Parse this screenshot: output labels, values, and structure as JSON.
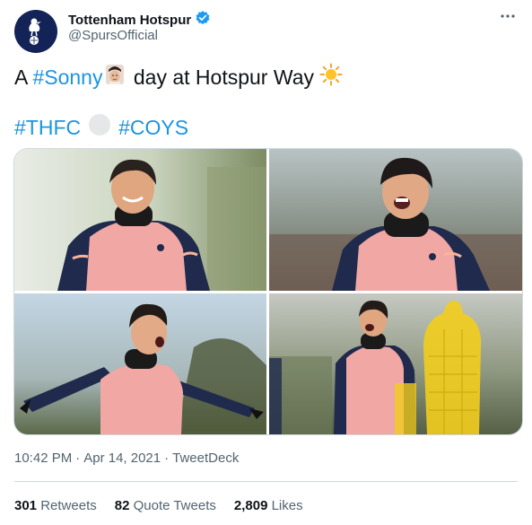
{
  "author": {
    "display_name": "Tottenham Hotspur",
    "handle": "@SpursOfficial",
    "verified": true,
    "avatar_bg": "#132257"
  },
  "tweet": {
    "line1": {
      "prefix": "A ",
      "hashtag": "#Sonny",
      "suffix": " day at Hotspur Way",
      "emoji_1": "face-icon",
      "emoji_2": "sun-icon"
    },
    "line2": {
      "hashtag_1": "#THFC",
      "hashtag_2": "#COYS",
      "emoji": "white-circle-icon"
    },
    "hashtag_color": "#1b95e0"
  },
  "meta": {
    "time": "10:42 PM",
    "date": "Apr 14, 2021",
    "separator": "·",
    "source": "TweetDeck"
  },
  "stats": {
    "retweets_count": "301",
    "retweets_label": "Retweets",
    "quotes_count": "82",
    "quotes_label": "Quote Tweets",
    "likes_count": "2,809",
    "likes_label": "Likes"
  },
  "colors": {
    "kit_pink": "#f1a7a4",
    "kit_navy": "#1f2a4d",
    "verified_blue": "#1d9bf0",
    "mannequin_yellow": "#f2cd1d"
  }
}
